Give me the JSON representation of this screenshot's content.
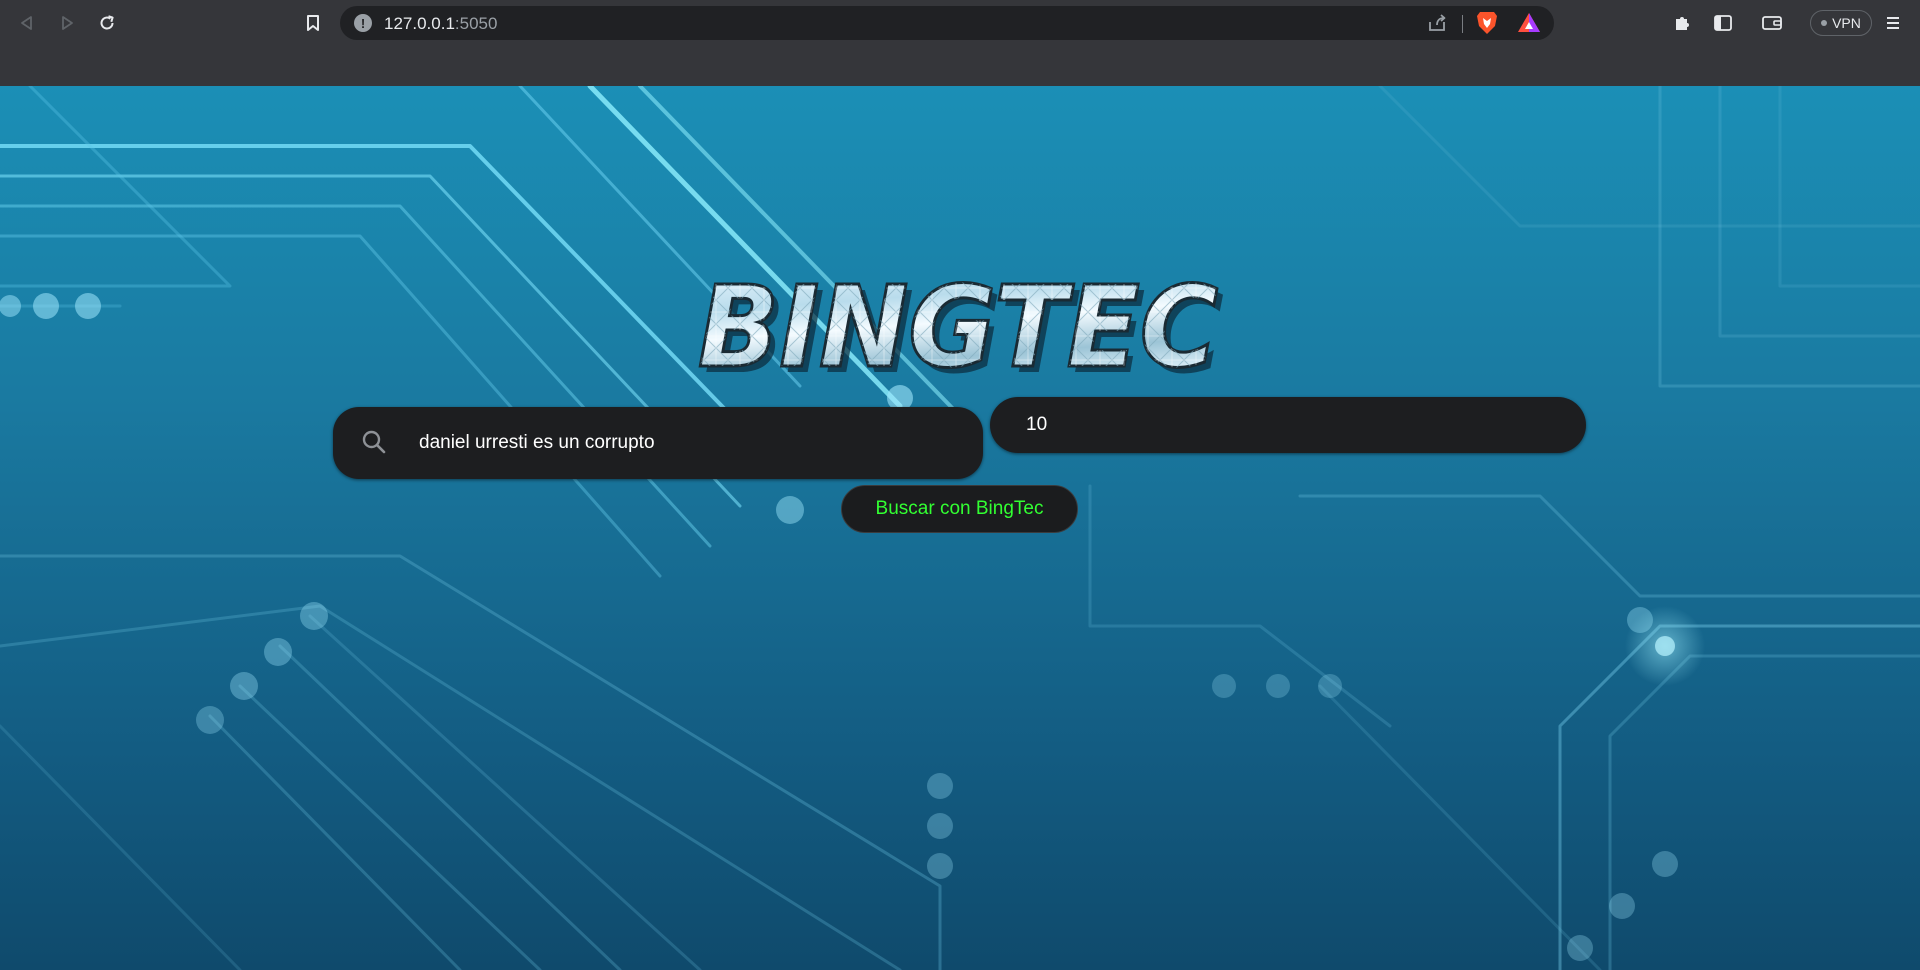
{
  "browser": {
    "url_host": "127.0.0.1",
    "url_port": ":5050",
    "vpn_label": "VPN"
  },
  "logo": {
    "text": "BINGTEC"
  },
  "search": {
    "query": "daniel urresti es un corrupto",
    "count": "10",
    "button_label": "Buscar con BingTec"
  },
  "colors": {
    "background": "#1a7aa1",
    "input_background": "#1d1e20",
    "button_text": "#32ff32"
  }
}
